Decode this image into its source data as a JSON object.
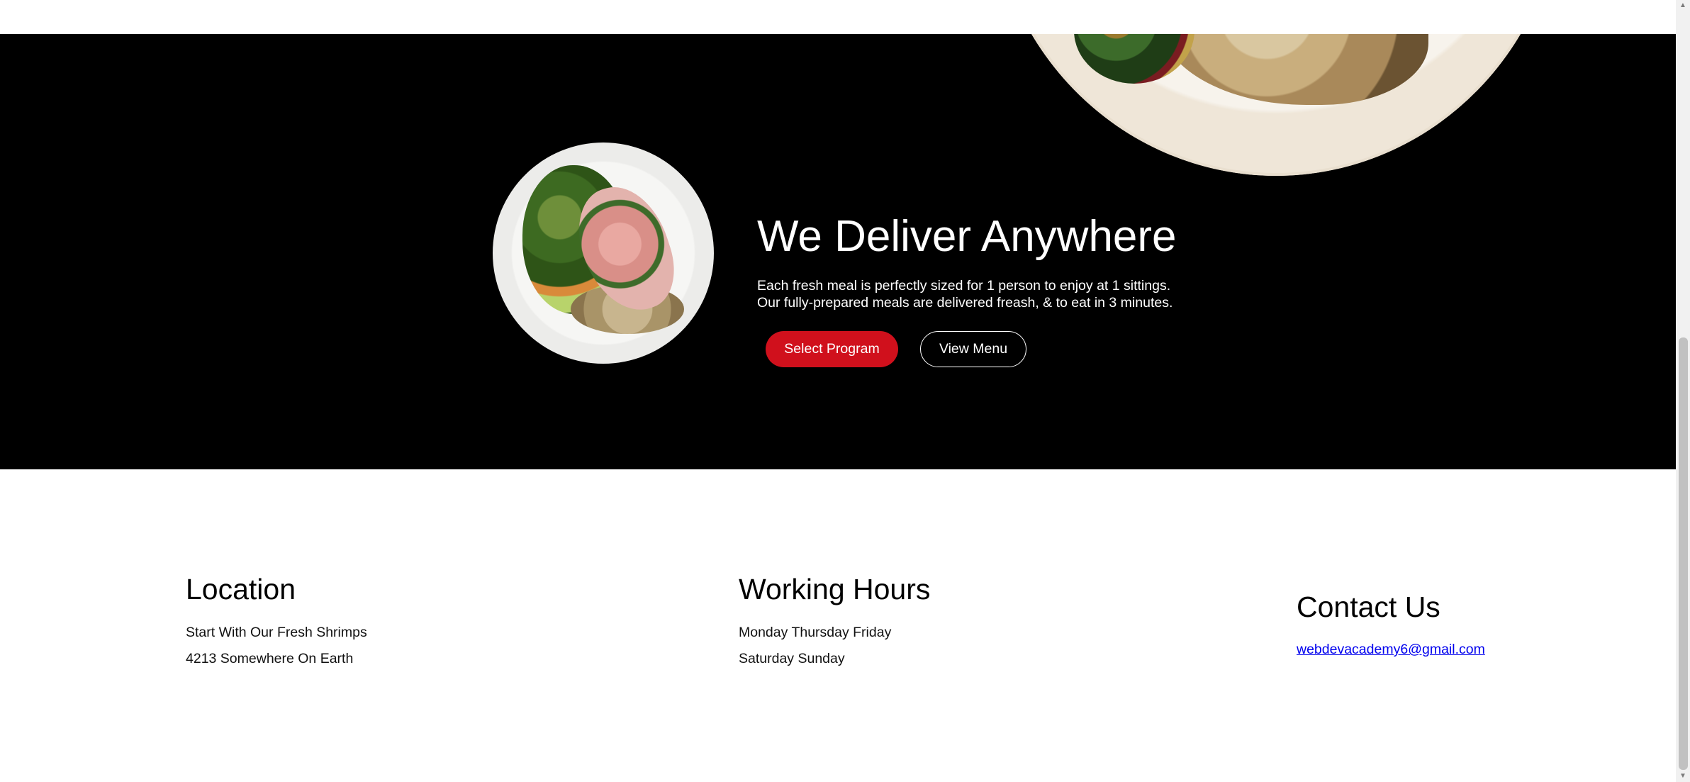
{
  "hero": {
    "title": "We Deliver Anywhere",
    "description_line1": "Each fresh meal is perfectly sized for 1 person to enjoy at 1 sittings.",
    "description_line2": "Our fully-prepared meals are delivered freash, & to eat in 3 minutes.",
    "primary_button": "Select Program",
    "secondary_button": "View Menu",
    "accent_color": "#d0101c"
  },
  "footer": {
    "location": {
      "heading": "Location",
      "line1": "Start With Our Fresh Shrimps",
      "line2": "4213 Somewhere On Earth"
    },
    "hours": {
      "heading": "Working Hours",
      "line1": "Monday Thursday Friday",
      "line2": "Saturday Sunday"
    },
    "contact": {
      "heading": "Contact Us",
      "email": "webdevacademy6@gmail.com"
    }
  },
  "icons": {
    "scroll_up": "scroll-up-icon",
    "scroll_down": "scroll-down-icon"
  }
}
